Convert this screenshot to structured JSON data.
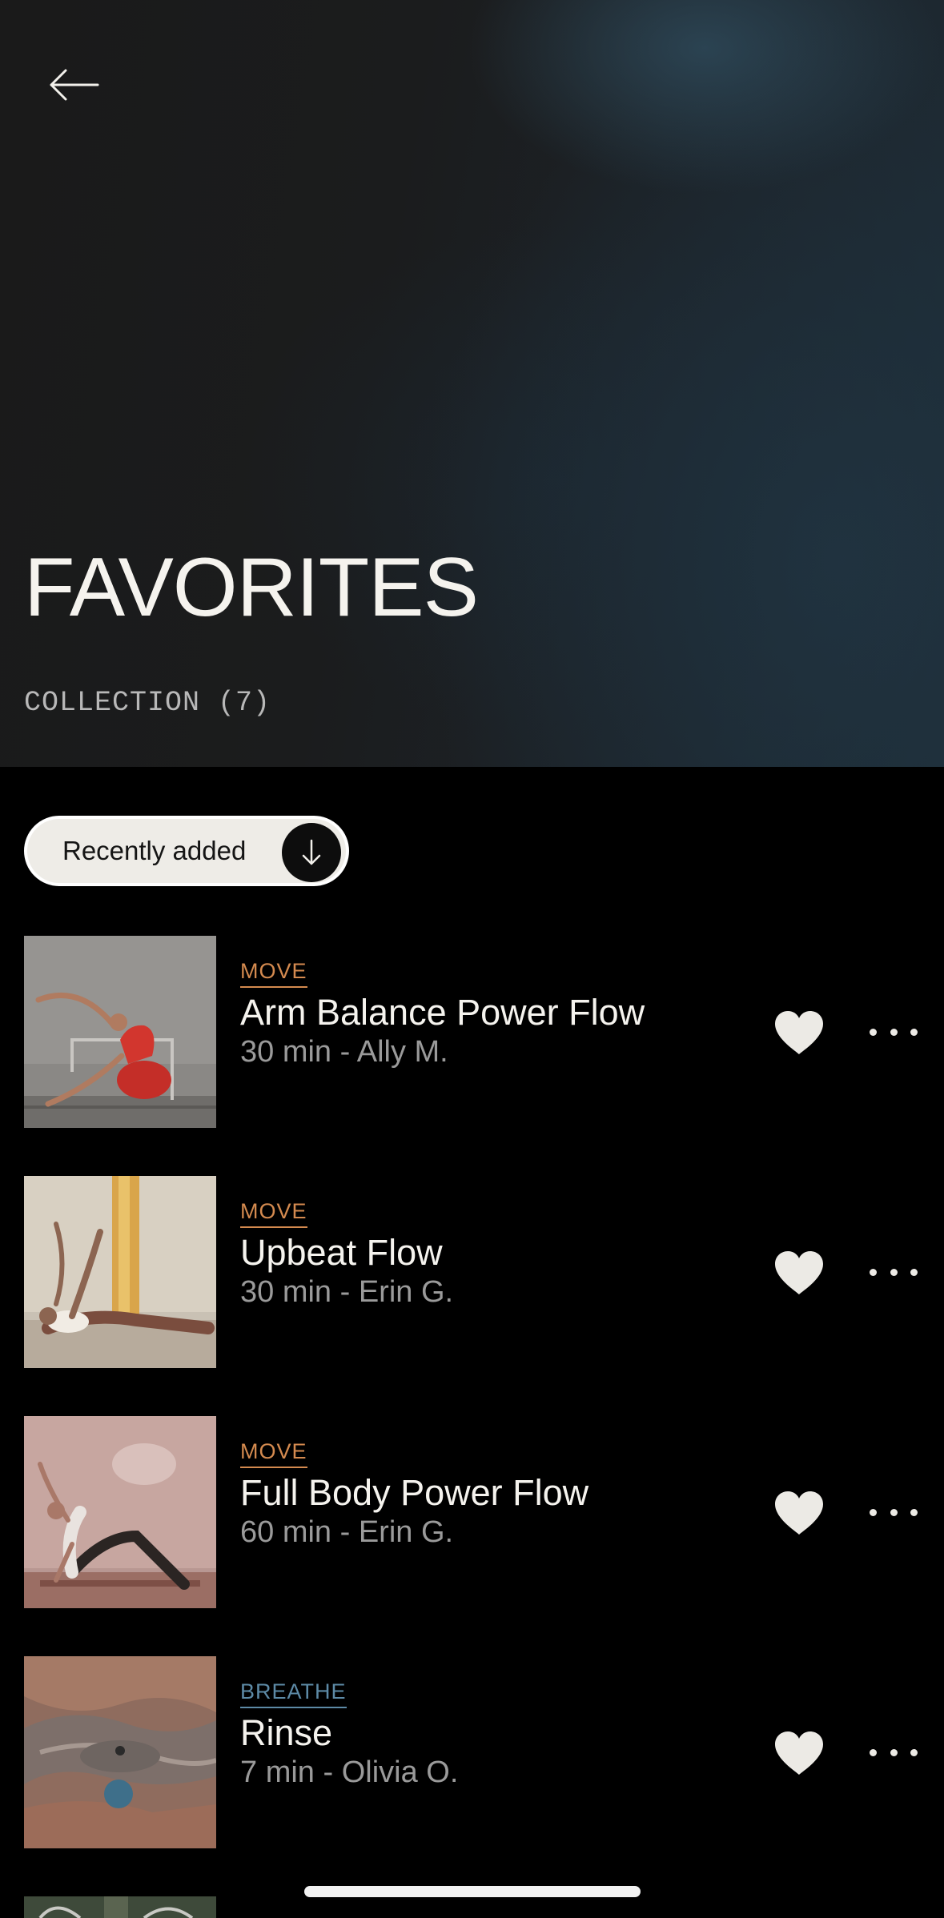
{
  "header": {
    "title": "FAVORITES",
    "collection_label": "COLLECTION (7)"
  },
  "sort": {
    "label": "Recently added"
  },
  "items": [
    {
      "category": "MOVE",
      "title": "Arm Balance Power Flow",
      "meta": "30 min - Ally M."
    },
    {
      "category": "MOVE",
      "title": "Upbeat Flow",
      "meta": "30 min - Erin G."
    },
    {
      "category": "MOVE",
      "title": "Full Body Power Flow",
      "meta": "60 min - Erin G."
    },
    {
      "category": "BREATHE",
      "title": "Rinse",
      "meta": "7 min - Olivia O."
    }
  ],
  "icons": {
    "back": "arrow-left-icon",
    "sort": "arrow-down-icon",
    "favorite": "heart-icon",
    "more": "more-horizontal-icon"
  },
  "colors": {
    "move": "#d48a4f",
    "breathe": "#5d8aa6",
    "background": "#000000"
  }
}
